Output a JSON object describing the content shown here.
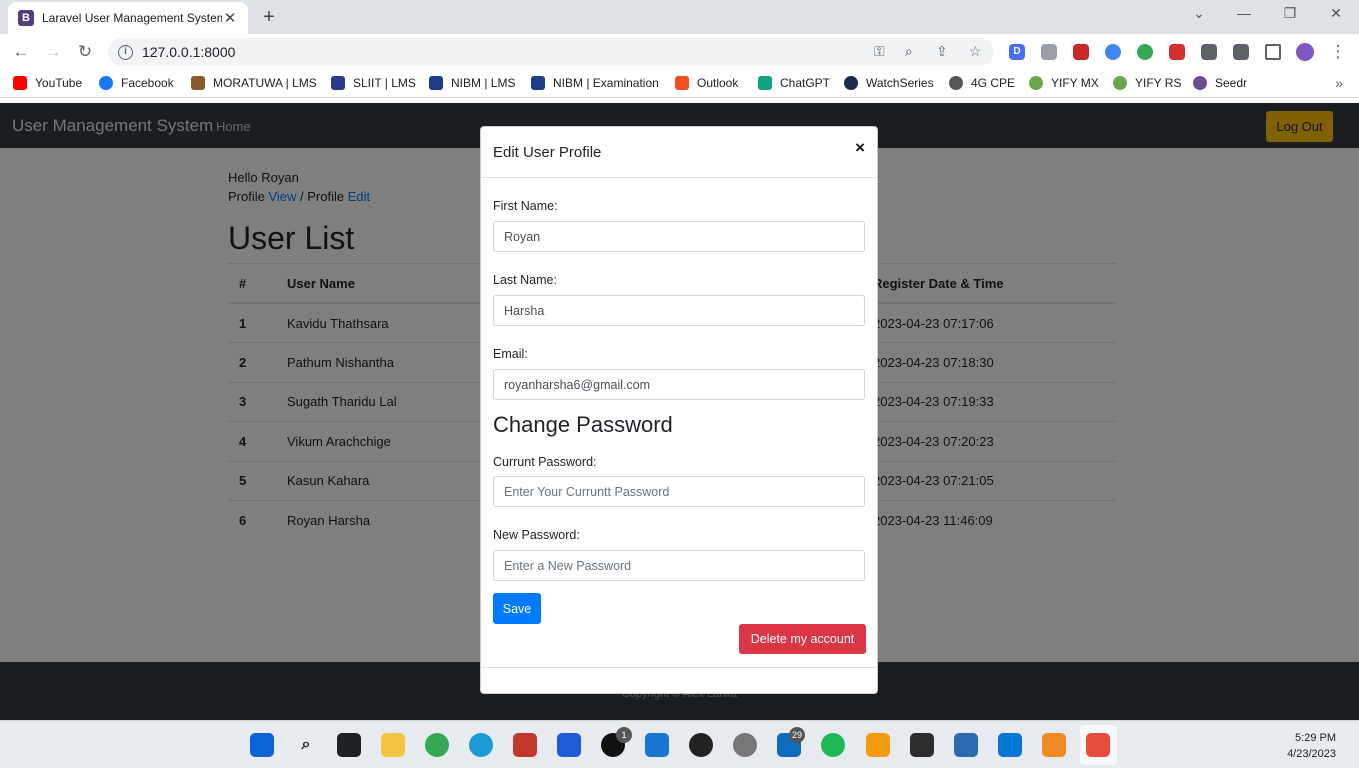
{
  "browser": {
    "tab_favicon": "B",
    "tab_title": "Laravel User Management System",
    "close_glyph": "✕",
    "new_tab_glyph": "+",
    "url": "127.0.0.1:8000",
    "window_controls": {
      "minimize": "—",
      "restore": "❐",
      "close": "✕",
      "tab_search": "⌄"
    }
  },
  "bookmarks": [
    {
      "label": "YouTube",
      "color": "#ff0000"
    },
    {
      "label": "Facebook",
      "color": "#1877f2"
    },
    {
      "label": "MORATUWA | LMS",
      "color": "#8a5a2a"
    },
    {
      "label": "SLIIT | LMS",
      "color": "#2b3a8f"
    },
    {
      "label": "NIBM | LMS",
      "color": "#1f3c88"
    },
    {
      "label": "NIBM | Examination",
      "color": "#1f3c88"
    },
    {
      "label": "Outlook",
      "color": "#f25022"
    },
    {
      "label": "ChatGPT",
      "color": "#10a37f"
    },
    {
      "label": "WatchSeries",
      "color": "#1a2a4a"
    },
    {
      "label": "4G CPE",
      "color": "#555555"
    },
    {
      "label": "YIFY MX",
      "color": "#6aa84f"
    },
    {
      "label": "YIFY RS",
      "color": "#6aa84f"
    },
    {
      "label": "Seedr",
      "color": "#6a4c93"
    }
  ],
  "app": {
    "brand": "User Management System",
    "nav_home": "Home",
    "logout": "Log Out",
    "greeting": "Hello Royan",
    "profile_prefix": "Profile ",
    "view_link": "View",
    "separator": " / Profile ",
    "edit_link": "Edit",
    "list_title": "User List",
    "table": {
      "headers": [
        "#",
        "User Name",
        "",
        "Register Date & Time"
      ],
      "rows": [
        {
          "num": "1",
          "name": "Kavidu Thathsara",
          "date": "2023-04-23 07:17:06"
        },
        {
          "num": "2",
          "name": "Pathum Nishantha",
          "date": "2023-04-23 07:18:30"
        },
        {
          "num": "3",
          "name": "Sugath Tharidu Lal",
          "date": "2023-04-23 07:19:33"
        },
        {
          "num": "4",
          "name": "Vikum Arachchige",
          "date": "2023-04-23 07:20:23"
        },
        {
          "num": "5",
          "name": "Kasun Kahara",
          "date": "2023-04-23 07:21:05"
        },
        {
          "num": "6",
          "name": "Royan Harsha",
          "date": "2023-04-23 11:46:09"
        }
      ]
    },
    "footer": "Copyright © Alex Lanka"
  },
  "modal": {
    "title": "Edit User Profile",
    "close": "×",
    "first_name_label": "First Name:",
    "first_name_value": "Royan",
    "last_name_label": "Last Name:",
    "last_name_value": "Harsha",
    "email_label": "Email:",
    "email_value": "royanharsha6@gmail.com",
    "password_section": "Change Password",
    "current_password_label": "Currunt Password:",
    "current_password_placeholder": "Enter Your Curruntt Password",
    "new_password_label": "New Password:",
    "new_password_placeholder": "Enter a New Password",
    "save": "Save",
    "delete": "Delete my account"
  },
  "taskbar": {
    "clock_time": "5:29 PM",
    "clock_date": "4/23/2023",
    "badges": {
      "xbox": "1",
      "outlook": "29"
    }
  }
}
